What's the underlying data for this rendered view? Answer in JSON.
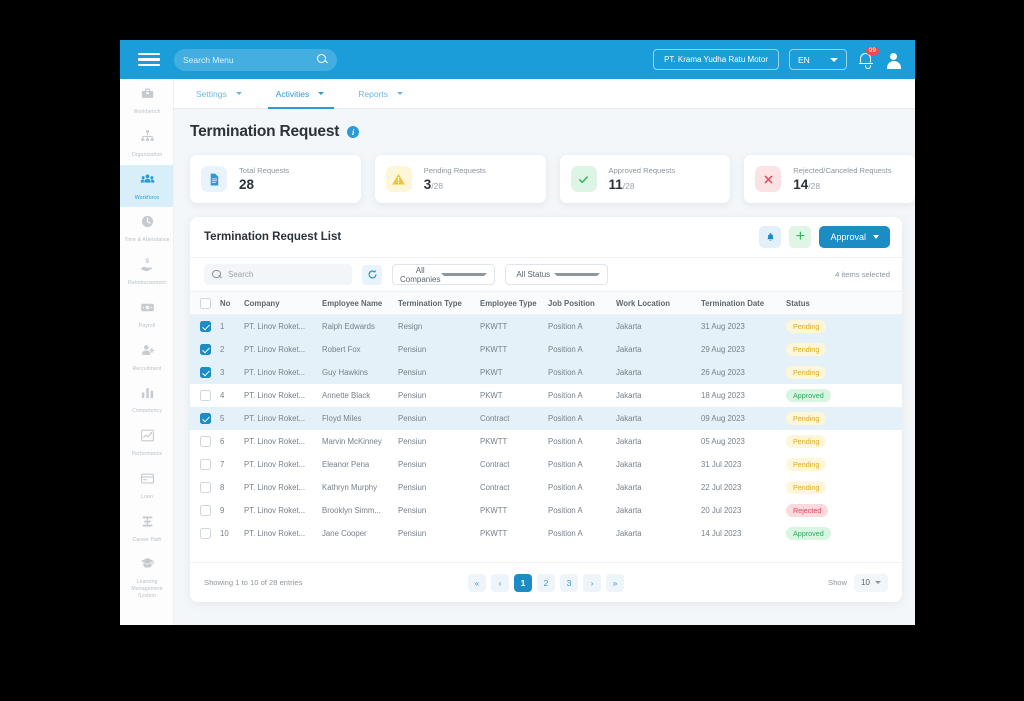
{
  "topbar": {
    "menu_icon": "hamburger-icon",
    "search_placeholder": "Search Menu",
    "search_icon": "search-icon",
    "company": "PT. Krama Yudha Ratu Motor",
    "language": "EN",
    "notification_count": "99",
    "bell_icon": "bell-icon",
    "avatar_icon": "user-avatar-icon",
    "bg_color": "#1b9dd9"
  },
  "sidebar": {
    "items": [
      {
        "label": "Workbench",
        "icon": "toolbox-icon",
        "active": false
      },
      {
        "label": "Organization",
        "icon": "org-chart-icon",
        "active": false
      },
      {
        "label": "Workforce",
        "icon": "people-group-icon",
        "active": true
      },
      {
        "label": "Time & Attendance",
        "icon": "clock-icon",
        "active": false
      },
      {
        "label": "Reimbursement",
        "icon": "hand-money-icon",
        "active": false
      },
      {
        "label": "Payroll",
        "icon": "banknote-icon",
        "active": false
      },
      {
        "label": "Recruitment",
        "icon": "user-plus-icon",
        "active": false
      },
      {
        "label": "Competency",
        "icon": "bar-chart-icon",
        "active": false
      },
      {
        "label": "Performance",
        "icon": "line-chart-icon",
        "active": false
      },
      {
        "label": "Loan",
        "icon": "credit-card-icon",
        "active": false
      },
      {
        "label": "Career Path",
        "icon": "career-path-icon",
        "active": false
      },
      {
        "label": "Learning Management System",
        "icon": "graduation-cap-icon",
        "active": false
      }
    ]
  },
  "navtabs": [
    {
      "label": "Settings",
      "active": false
    },
    {
      "label": "Activities",
      "active": true
    },
    {
      "label": "Reports",
      "active": false
    }
  ],
  "page": {
    "title": "Termination Request",
    "info_icon": "info-icon"
  },
  "stats": [
    {
      "label": "Total Requests",
      "value": "28",
      "total": "",
      "icon": "document-icon",
      "icon_bg": "#e8f3fb",
      "icon_color": "#2a9bd4"
    },
    {
      "label": "Pending Requests",
      "value": "3",
      "total": "/28",
      "icon": "warning-triangle-icon",
      "icon_bg": "#fdf6d8",
      "icon_color": "#f2c42e"
    },
    {
      "label": "Approved Requests",
      "value": "11",
      "total": "/28",
      "icon": "check-circle-icon",
      "icon_bg": "#ddf5e5",
      "icon_color": "#35b55f"
    },
    {
      "label": "Rejected/Canceled Requests",
      "value": "14",
      "total": "/28",
      "icon": "x-circle-icon",
      "icon_bg": "#fbe2e4",
      "icon_color": "#e0465c"
    }
  ],
  "list": {
    "title": "Termination Request List",
    "bell_button_icon": "bell-icon",
    "add_button_icon": "plus-icon",
    "approval_label": "Approval",
    "search_placeholder": "Search",
    "refresh_icon": "refresh-icon",
    "filter_company": "All Companies",
    "filter_status": "All Status",
    "selected_text": "4 items selected"
  },
  "table": {
    "columns": [
      "No",
      "Company",
      "Employee Name",
      "Termination Type",
      "Employee Type",
      "Job Position",
      "Work Location",
      "Termination Date",
      "Status"
    ],
    "rows": [
      {
        "checked": true,
        "no": "1",
        "company": "PT. Linov Roket...",
        "name": "Ralph Edwards",
        "ttype": "Resign",
        "etype": "PKWTT",
        "job": "Position A",
        "loc": "Jakarta",
        "date": "31 Aug 2023",
        "status": "Pending",
        "status_kind": "pending"
      },
      {
        "checked": true,
        "no": "2",
        "company": "PT. Linov Roket...",
        "name": "Robert Fox",
        "ttype": "Pensiun",
        "etype": "PKWTT",
        "job": "Position A",
        "loc": "Jakarta",
        "date": "29 Aug 2023",
        "status": "Pending",
        "status_kind": "pending"
      },
      {
        "checked": true,
        "no": "3",
        "company": "PT. Linov Roket...",
        "name": "Guy Hawkins",
        "ttype": "Pensiun",
        "etype": "PKWT",
        "job": "Position A",
        "loc": "Jakarta",
        "date": "26 Aug 2023",
        "status": "Pending",
        "status_kind": "pending"
      },
      {
        "checked": false,
        "no": "4",
        "company": "PT. Linov Roket...",
        "name": "Annette Black",
        "ttype": "Pensiun",
        "etype": "PKWT",
        "job": "Position A",
        "loc": "Jakarta",
        "date": "18 Aug 2023",
        "status": "Approved",
        "status_kind": "approved"
      },
      {
        "checked": true,
        "no": "5",
        "company": "PT. Linov Roket...",
        "name": "Floyd Miles",
        "ttype": "Pensiun",
        "etype": "Contract",
        "job": "Position A",
        "loc": "Jakarta",
        "date": "09 Aug 2023",
        "status": "Pending",
        "status_kind": "pending"
      },
      {
        "checked": false,
        "no": "6",
        "company": "PT. Linov Roket...",
        "name": "Marvin McKinney",
        "ttype": "Pensiun",
        "etype": "PKWTT",
        "job": "Position A",
        "loc": "Jakarta",
        "date": "05 Aug 2023",
        "status": "Pending",
        "status_kind": "pending"
      },
      {
        "checked": false,
        "no": "7",
        "company": "PT. Linov Roket...",
        "name": "Eleanor Pena",
        "ttype": "Pensiun",
        "etype": "Contract",
        "job": "Position A",
        "loc": "Jakarta",
        "date": "31 Jul 2023",
        "status": "Pending",
        "status_kind": "pending"
      },
      {
        "checked": false,
        "no": "8",
        "company": "PT. Linov Roket...",
        "name": "Kathryn Murphy",
        "ttype": "Pensiun",
        "etype": "Contract",
        "job": "Position A",
        "loc": "Jakarta",
        "date": "22 Jul 2023",
        "status": "Pending",
        "status_kind": "pending"
      },
      {
        "checked": false,
        "no": "9",
        "company": "PT. Linov Roket...",
        "name": "Brooklyn Simm...",
        "ttype": "Pensiun",
        "etype": "PKWTT",
        "job": "Position A",
        "loc": "Jakarta",
        "date": "20 Jul 2023",
        "status": "Rejected",
        "status_kind": "rejected"
      },
      {
        "checked": false,
        "no": "10",
        "company": "PT. Linov Roket...",
        "name": "Jane Cooper",
        "ttype": "Pensiun",
        "etype": "PKWTT",
        "job": "Position A",
        "loc": "Jakarta",
        "date": "14 Jul 2023",
        "status": "Approved",
        "status_kind": "approved"
      }
    ]
  },
  "footer": {
    "showing": "Showing 1 to 10 of 28 entries",
    "pages": [
      "«",
      "‹",
      "1",
      "2",
      "3",
      "›",
      "»"
    ],
    "current_page": "1",
    "show_label": "Show",
    "show_value": "10"
  }
}
